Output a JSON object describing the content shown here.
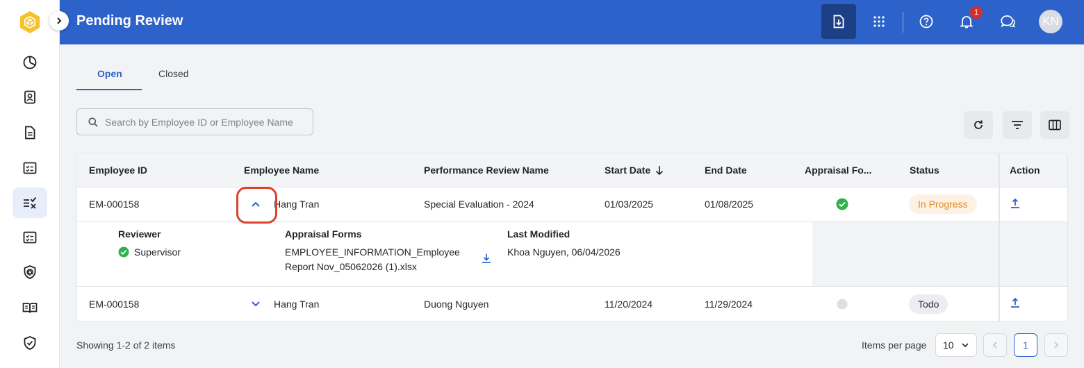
{
  "header": {
    "title": "Pending Review",
    "notifications_count": "1",
    "user_initials": "KN"
  },
  "tabs": [
    {
      "label": "Open",
      "active": true
    },
    {
      "label": "Closed",
      "active": false
    }
  ],
  "search": {
    "placeholder": "Search by Employee ID or Employee Name",
    "value": ""
  },
  "table": {
    "columns": [
      "Employee ID",
      "Employee Name",
      "Performance Review Name",
      "Start Date",
      "End Date",
      "Appraisal Fo...",
      "Status",
      "Action"
    ],
    "sort": {
      "column": "Start Date",
      "direction": "descending"
    },
    "rows": [
      {
        "employee_id": "EM-000158",
        "employee_name": "Hang Tran",
        "review_name": "Special Evaluation - 2024",
        "start_date": "01/03/2025",
        "end_date": "01/08/2025",
        "appraisal_complete": true,
        "status": "In Progress",
        "expanded": true,
        "details": {
          "reviewer_label": "Reviewer",
          "reviewer": "Supervisor",
          "forms_label": "Appraisal Forms",
          "form_line1": "EMPLOYEE_INFORMATION_Employee",
          "form_line2": "Report Nov_05062026 (1).xlsx",
          "modified_label": "Last Modified",
          "modified": "Khoa Nguyen, 06/04/2026"
        }
      },
      {
        "employee_id": "EM-000158",
        "employee_name": "Hang Tran",
        "review_name": "Duong Nguyen",
        "start_date": "11/20/2024",
        "end_date": "11/29/2024",
        "appraisal_complete": false,
        "status": "Todo",
        "expanded": false
      }
    ]
  },
  "footer": {
    "showing": "Showing 1-2 of 2 items",
    "items_per_page_label": "Items per page",
    "items_per_page": "10",
    "current_page": "1"
  },
  "colors": {
    "brand": "#2c62c9",
    "success": "#2eb34a",
    "in_progress": "#e58a1f",
    "highlight": "#e0402a"
  }
}
